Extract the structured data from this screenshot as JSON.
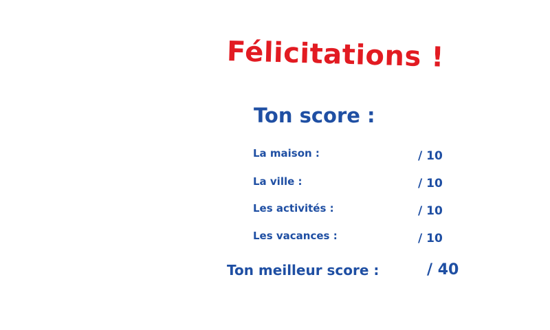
{
  "title": "Félicitations !",
  "score_heading": "Ton score :",
  "scores": [
    {
      "label": "La maison :",
      "value": "/ 10"
    },
    {
      "label": "La ville :",
      "value": "/ 10"
    },
    {
      "label": "Les activités :",
      "value": "/ 10"
    },
    {
      "label": "Les vacances :",
      "value": "/ 10"
    }
  ],
  "best": {
    "label": "Ton meilleur score :",
    "value": "/ 40"
  },
  "colors": {
    "title": "#e21b22",
    "text": "#1f4fa3",
    "background": "#ffffff"
  }
}
